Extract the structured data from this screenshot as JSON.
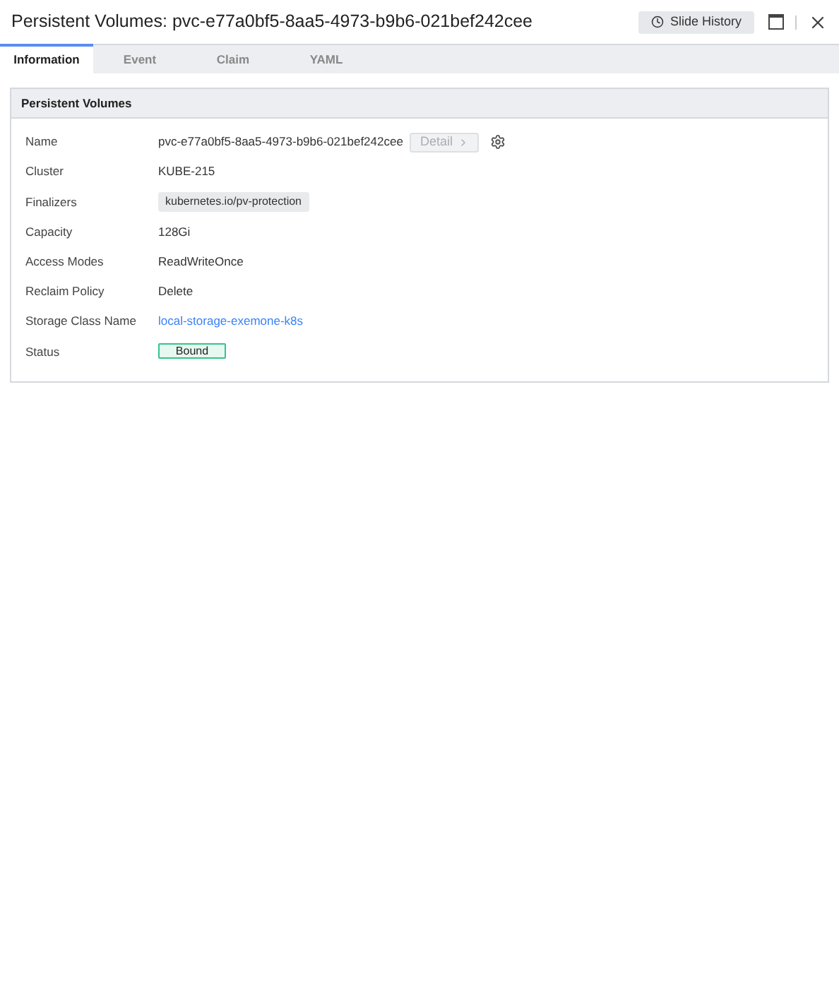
{
  "window": {
    "title": "Persistent Volumes: pvc-e77a0bf5-8aa5-4973-b9b6-021bef242cee",
    "history_button": "Slide History"
  },
  "tabs": [
    {
      "label": "Information",
      "selected": true
    },
    {
      "label": "Event",
      "selected": false
    },
    {
      "label": "Claim",
      "selected": false
    },
    {
      "label": "YAML",
      "selected": false
    }
  ],
  "panel": {
    "title": "Persistent Volumes",
    "rows": [
      {
        "kind": "name",
        "label": "Name",
        "value": "pvc-e77a0bf5-8aa5-4973-b9b6-021bef242cee",
        "button": {
          "label": "Detail",
          "disabled": true
        }
      },
      {
        "kind": "text",
        "label": "Cluster",
        "value": "KUBE-215"
      },
      {
        "kind": "tag",
        "label": "Finalizers",
        "value": "kubernetes.io/pv-protection"
      },
      {
        "kind": "text",
        "label": "Capacity",
        "value": "128Gi"
      },
      {
        "kind": "text",
        "label": "Access Modes",
        "value": "ReadWriteOnce"
      },
      {
        "kind": "text",
        "label": "Reclaim Policy",
        "value": "Delete"
      },
      {
        "kind": "link",
        "label": "Storage Class Name",
        "value": "local-storage-exemone-k8s"
      },
      {
        "kind": "status",
        "label": "Status",
        "value": "Bound"
      }
    ]
  }
}
